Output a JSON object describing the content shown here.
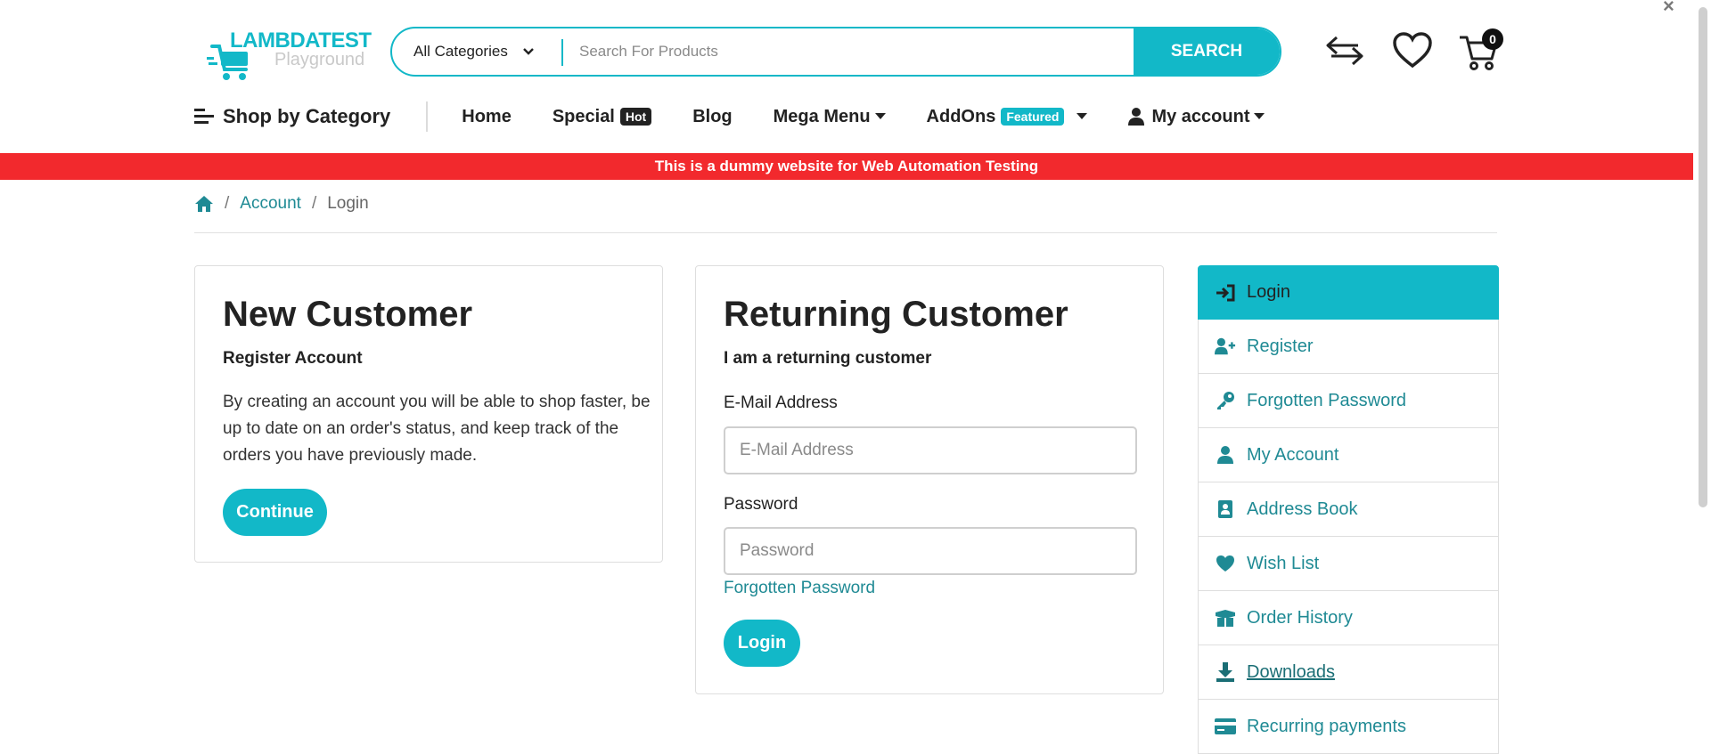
{
  "header": {
    "logo_title": "LAMBDATEST",
    "logo_subtitle": "Playground",
    "category_select": "All Categories",
    "search_placeholder": "Search For Products",
    "search_button": "SEARCH",
    "cart_count": "0"
  },
  "nav": {
    "shop_by_category": "Shop by Category",
    "items": [
      {
        "label": "Home"
      },
      {
        "label": "Special",
        "badge": "Hot"
      },
      {
        "label": "Blog"
      },
      {
        "label": "Mega Menu"
      },
      {
        "label": "AddOns",
        "badge": "Featured"
      },
      {
        "label": "My account"
      }
    ]
  },
  "notice": "This is a dummy website for Web Automation Testing",
  "breadcrumb": {
    "items": [
      "Account",
      "Login"
    ]
  },
  "new_customer": {
    "title": "New Customer",
    "subtitle": "Register Account",
    "body": "By creating an account you will be able to shop faster, be up to date on an order's status, and keep track of the orders you have previously made.",
    "button": "Continue"
  },
  "returning_customer": {
    "title": "Returning Customer",
    "subtitle": "I am a returning customer",
    "email_label": "E-Mail Address",
    "email_placeholder": "E-Mail Address",
    "password_label": "Password",
    "password_placeholder": "Password",
    "forgot_link": "Forgotten Password",
    "button": "Login"
  },
  "sidebar": {
    "items": [
      {
        "label": "Login",
        "icon": "sign-in-icon"
      },
      {
        "label": "Register",
        "icon": "user-plus-icon"
      },
      {
        "label": "Forgotten Password",
        "icon": "key-icon"
      },
      {
        "label": "My Account",
        "icon": "user-icon"
      },
      {
        "label": "Address Book",
        "icon": "address-book-icon"
      },
      {
        "label": "Wish List",
        "icon": "heart-icon"
      },
      {
        "label": "Order History",
        "icon": "box-open-icon"
      },
      {
        "label": "Downloads",
        "icon": "download-icon"
      },
      {
        "label": "Recurring payments",
        "icon": "credit-card-icon"
      }
    ]
  },
  "colors": {
    "accent": "#12b8c8",
    "link": "#1f8a94",
    "notice_bg": "#f2292d"
  }
}
